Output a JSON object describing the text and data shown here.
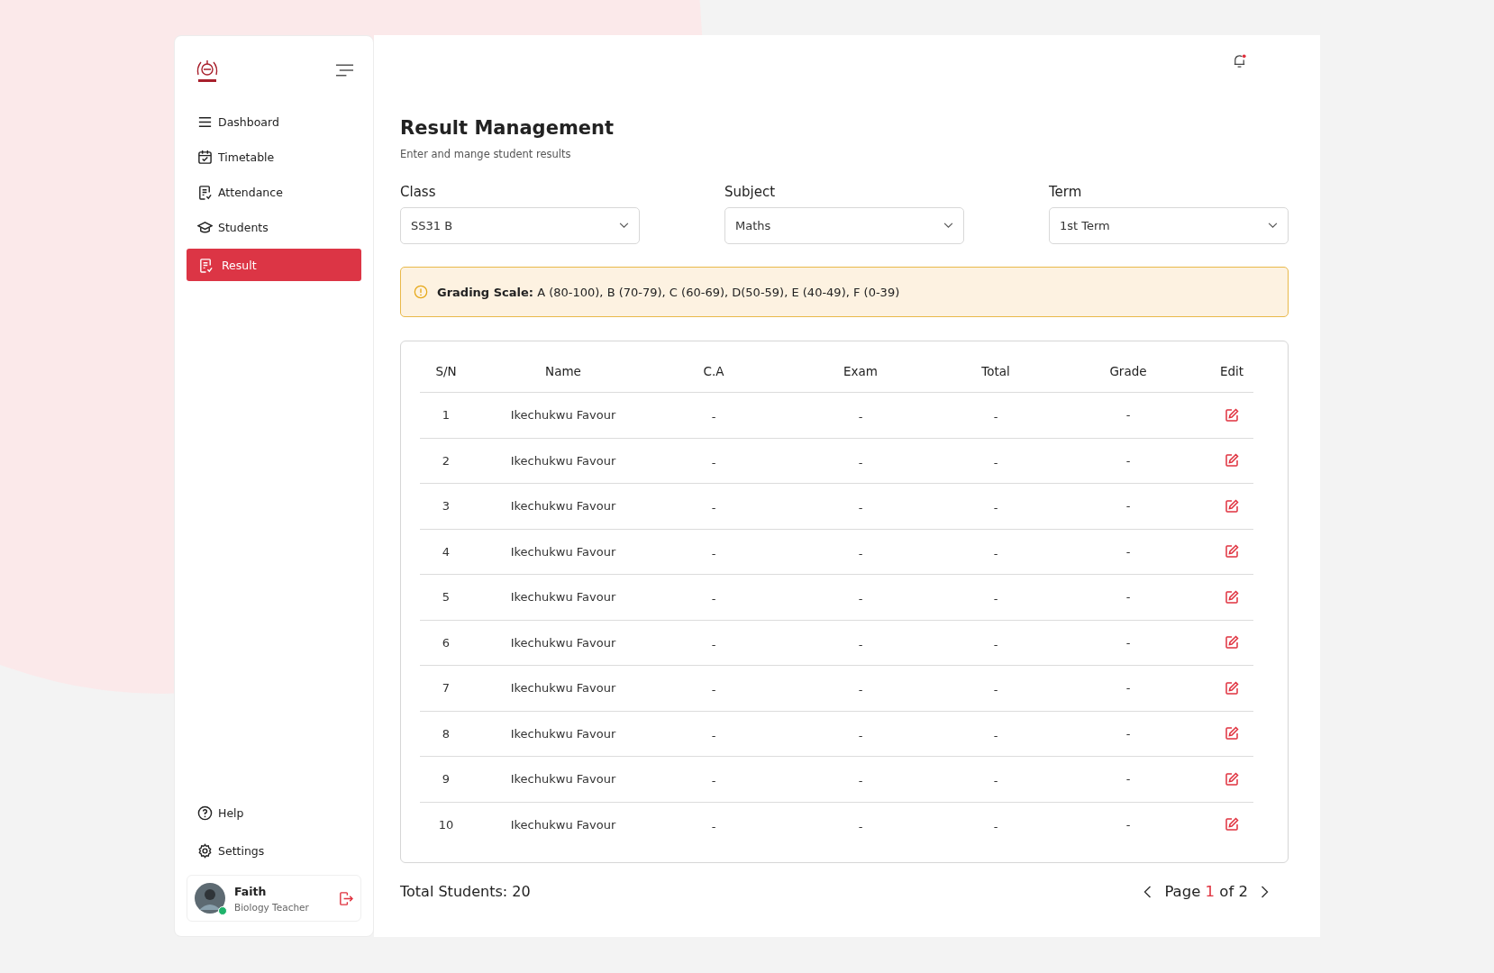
{
  "sidebar": {
    "nav": [
      {
        "label": "Dashboard",
        "selected": false
      },
      {
        "label": "Timetable",
        "selected": false
      },
      {
        "label": "Attendance",
        "selected": false
      },
      {
        "label": "Students",
        "selected": false
      },
      {
        "label": "Result",
        "selected": true
      }
    ],
    "bottom": [
      {
        "label": "Help"
      },
      {
        "label": "Settings"
      }
    ],
    "user": {
      "name": "Faith",
      "role": "Biology Teacher",
      "online": true
    }
  },
  "header": {
    "has_notification": true
  },
  "page": {
    "title": "Result Management",
    "subtitle": "Enter and mange student results"
  },
  "filters": [
    {
      "label": "Class",
      "value": "SS31 B"
    },
    {
      "label": "Subject",
      "value": "Maths"
    },
    {
      "label": "Term",
      "value": "1st Term"
    }
  ],
  "notice": {
    "text": "**Grading Scale:** A (80-100), B (70-79), C (60-69), D(50-59), E (40-49), F (0-39)"
  },
  "table": {
    "columns": [
      "S/N",
      "Name",
      "C.A",
      "Exam",
      "Total",
      "Grade",
      "Edit"
    ],
    "rows": [
      {
        "sn": "1",
        "name": "Ikechukwu Favour",
        "ca": "-",
        "exam": "-",
        "total": "-",
        "grade": "-"
      },
      {
        "sn": "2",
        "name": "Ikechukwu Favour",
        "ca": "-",
        "exam": "-",
        "total": "-",
        "grade": "-"
      },
      {
        "sn": "3",
        "name": "Ikechukwu Favour",
        "ca": "-",
        "exam": "-",
        "total": "-",
        "grade": "-"
      },
      {
        "sn": "4",
        "name": "Ikechukwu Favour",
        "ca": "-",
        "exam": "-",
        "total": "-",
        "grade": "-"
      },
      {
        "sn": "5",
        "name": "Ikechukwu Favour",
        "ca": "-",
        "exam": "-",
        "total": "-",
        "grade": "-"
      },
      {
        "sn": "6",
        "name": "Ikechukwu Favour",
        "ca": "-",
        "exam": "-",
        "total": "-",
        "grade": "-"
      },
      {
        "sn": "7",
        "name": "Ikechukwu Favour",
        "ca": "-",
        "exam": "-",
        "total": "-",
        "grade": "-"
      },
      {
        "sn": "8",
        "name": "Ikechukwu Favour",
        "ca": "-",
        "exam": "-",
        "total": "-",
        "grade": "-"
      },
      {
        "sn": "9",
        "name": "Ikechukwu Favour",
        "ca": "-",
        "exam": "-",
        "total": "-",
        "grade": "-"
      },
      {
        "sn": "10",
        "name": "Ikechukwu Favour",
        "ca": "-",
        "exam": "-",
        "total": "-",
        "grade": "-"
      }
    ]
  },
  "footer": {
    "total": "Total Students: 20",
    "pagination": {
      "label": "Page",
      "current": "1",
      "of": "of",
      "total": "2"
    }
  }
}
